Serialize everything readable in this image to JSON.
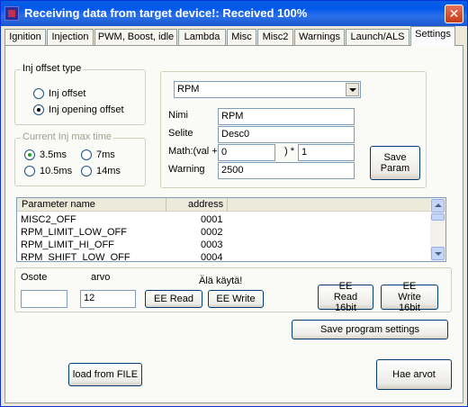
{
  "window": {
    "title": "Receiving data from target device!:  Received 100%",
    "close": "✕"
  },
  "tabs": [
    "Ignition",
    "Injection",
    "PWM, Boost, idle",
    "Lambda",
    "Misc",
    "Misc2",
    "Warnings",
    "Launch/ALS",
    "Settings"
  ],
  "active_tab": "Settings",
  "inj_offset": {
    "title": "Inj offset type",
    "options": [
      "Inj offset",
      "Inj opening offset"
    ],
    "selected": "Inj opening offset"
  },
  "inj_max": {
    "title": "Current Inj max time",
    "options": [
      "3.5ms",
      "7ms",
      "10.5ms",
      "14ms"
    ],
    "selected": "3.5ms"
  },
  "param": {
    "select_value": "RPM",
    "nimi_label": "Nimi",
    "nimi_value": "RPM",
    "selite_label": "Selite",
    "selite_value": "Desc0",
    "math_label": "Math:(val +",
    "math_offset": "0",
    "math_mid": ") *",
    "math_factor": "1",
    "warning_label": "Warning",
    "warning_value": "2500",
    "save_label": "Save Param"
  },
  "table": {
    "columns": [
      "Parameter name",
      "address"
    ],
    "rows": [
      [
        "MISC2_OFF",
        "0001"
      ],
      [
        "RPM_LIMIT_LOW_OFF",
        "0002"
      ],
      [
        "RPM_LIMIT_HI_OFF",
        "0003"
      ],
      [
        "RPM_SHIFT_LOW_OFF",
        "0004"
      ]
    ]
  },
  "ee": {
    "osote_label": "Osote",
    "osote_value": "",
    "arvo_label": "arvo",
    "arvo_value": "12",
    "warning": "Älä käytä!",
    "read": "EE Read",
    "write": "EE Write",
    "read16": "EE Read 16bit",
    "write16": "EE Write 16bit"
  },
  "save_settings": "Save program settings",
  "load_file": "load from FILE",
  "hae_arvot": "Hae arvot"
}
